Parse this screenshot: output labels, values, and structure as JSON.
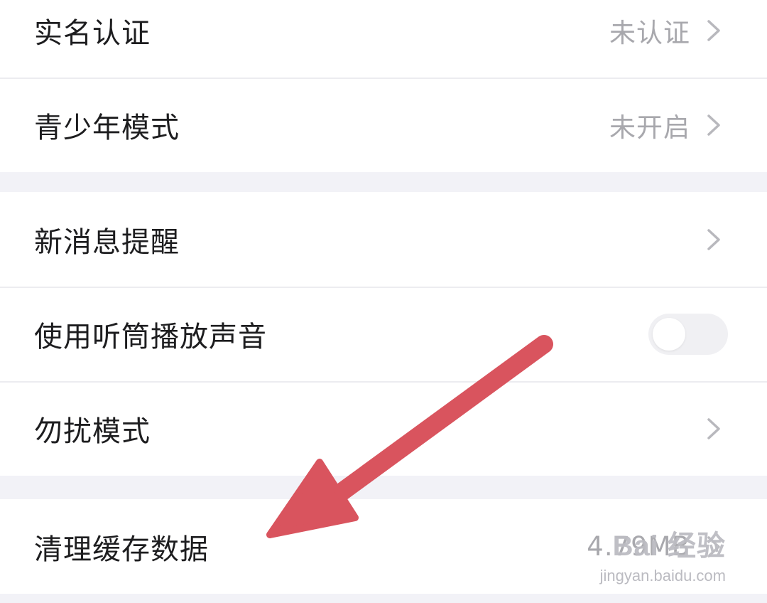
{
  "group1": {
    "items": [
      {
        "label": "实名认证",
        "value": "未认证"
      },
      {
        "label": "青少年模式",
        "value": "未开启"
      }
    ]
  },
  "group2": {
    "items": [
      {
        "label": "新消息提醒"
      },
      {
        "label": "使用听筒播放声音",
        "toggle": false
      },
      {
        "label": "勿扰模式"
      }
    ]
  },
  "group3": {
    "items": [
      {
        "label": "清理缓存数据",
        "value": "4.79MB"
      }
    ]
  },
  "icons": {
    "chevron": "chevron-right-icon",
    "annotation": "red-arrow-icon"
  },
  "watermark": {
    "main": "Bai 经验",
    "sub": "jingyan.baidu.com"
  },
  "colors": {
    "background": "#f2f2f7",
    "card": "#ffffff",
    "label": "#1d1d1f",
    "value": "#a8a8ad",
    "arrow": "#d9545e"
  }
}
